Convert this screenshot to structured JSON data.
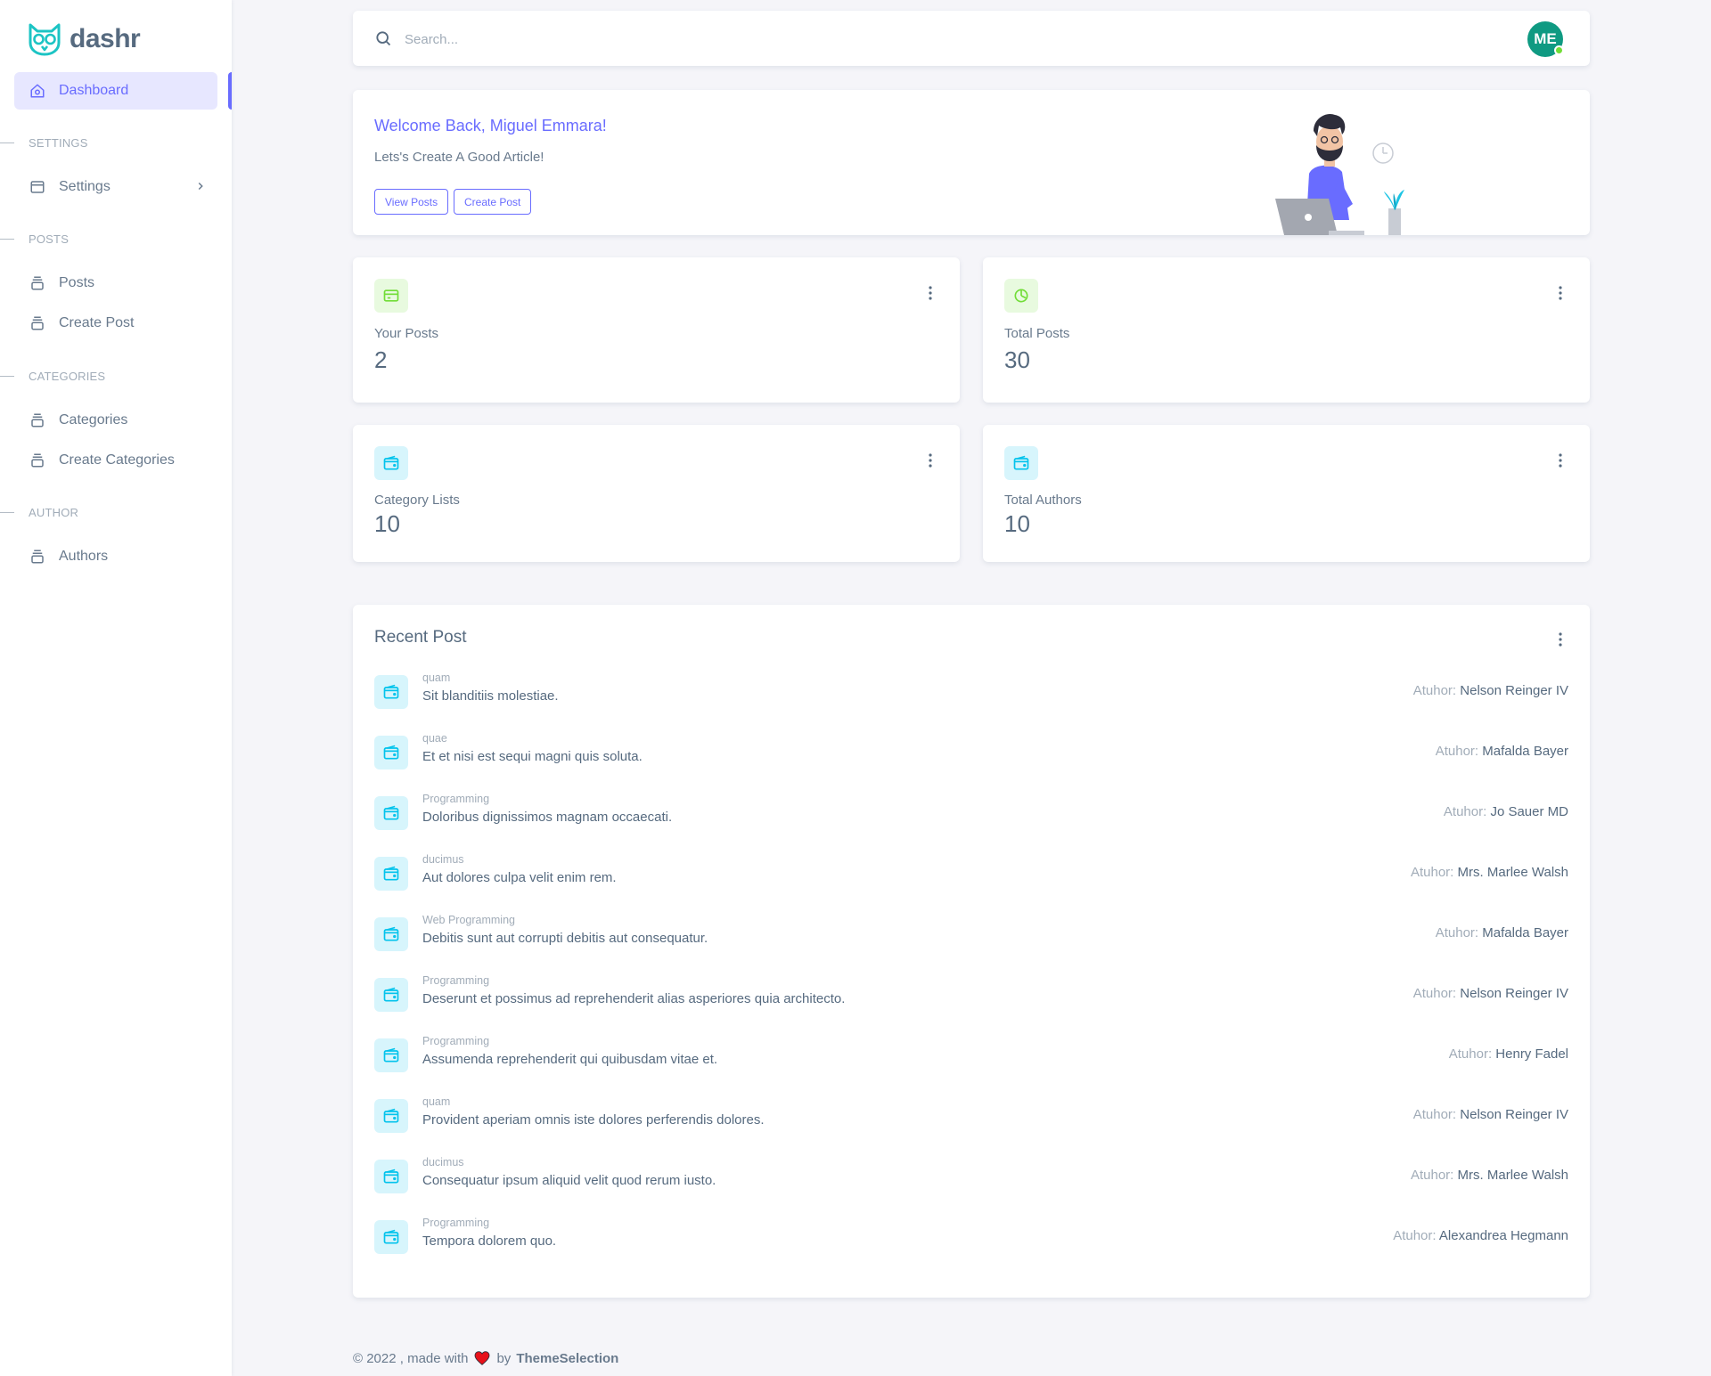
{
  "brand": {
    "name": "dashr"
  },
  "sidebar": {
    "active_item": "Dashboard",
    "sections": [
      {
        "header": "SETTINGS",
        "items": [
          "Settings"
        ]
      },
      {
        "header": "POSTS",
        "items": [
          "Posts",
          "Create Post"
        ]
      },
      {
        "header": "CATEGORIES",
        "items": [
          "Categories",
          "Create Categories"
        ]
      },
      {
        "header": "AUTHOR",
        "items": [
          "Authors"
        ]
      }
    ]
  },
  "navbar": {
    "search_placeholder": "Search...",
    "avatar_initials": "ME"
  },
  "welcome": {
    "title": "Welcome Back, Miguel Emmara!",
    "subtitle": "Lets's Create A Good Article!",
    "view_posts": "View Posts",
    "create_post": "Create Post"
  },
  "stats": [
    {
      "label": "Your Posts",
      "value": "2",
      "icon": "credit-card-icon"
    },
    {
      "label": "Total Posts",
      "value": "30",
      "icon": "pie-chart-icon"
    },
    {
      "label": "Category Lists",
      "value": "10",
      "icon": "wallet-icon"
    },
    {
      "label": "Total Authors",
      "value": "10",
      "icon": "wallet-icon"
    }
  ],
  "recent": {
    "title": "Recent Post",
    "author_label": "Atuhor:",
    "posts": [
      {
        "category": "quam",
        "title": "Sit blanditiis molestiae.",
        "author": "Nelson Reinger IV"
      },
      {
        "category": "quae",
        "title": "Et et nisi est sequi magni quis soluta.",
        "author": "Mafalda Bayer"
      },
      {
        "category": "Programming",
        "title": "Doloribus dignissimos magnam occaecati.",
        "author": "Jo Sauer MD"
      },
      {
        "category": "ducimus",
        "title": "Aut dolores culpa velit enim rem.",
        "author": "Mrs. Marlee Walsh"
      },
      {
        "category": "Web Programming",
        "title": "Debitis sunt aut corrupti debitis aut consequatur.",
        "author": "Mafalda Bayer"
      },
      {
        "category": "Programming",
        "title": "Deserunt et possimus ad reprehenderit alias asperiores quia architecto.",
        "author": "Nelson Reinger IV"
      },
      {
        "category": "Programming",
        "title": "Assumenda reprehenderit qui quibusdam vitae et.",
        "author": "Henry Fadel"
      },
      {
        "category": "quam",
        "title": "Provident aperiam omnis iste dolores perferendis dolores.",
        "author": "Nelson Reinger IV"
      },
      {
        "category": "ducimus",
        "title": "Consequatur ipsum aliquid velit quod rerum iusto.",
        "author": "Mrs. Marlee Walsh"
      },
      {
        "category": "Programming",
        "title": "Tempora dolorem quo.",
        "author": "Alexandrea Hegmann"
      }
    ]
  },
  "footer": {
    "prefix": "© 2022 , made with",
    "by": "by",
    "brand": "ThemeSelection"
  },
  "colors": {
    "primary": "#696cff",
    "success": "#71dd37",
    "info": "#03c3ec",
    "heading": "#566a7f",
    "muted": "#a1acb8",
    "background": "#f5f5f9"
  }
}
